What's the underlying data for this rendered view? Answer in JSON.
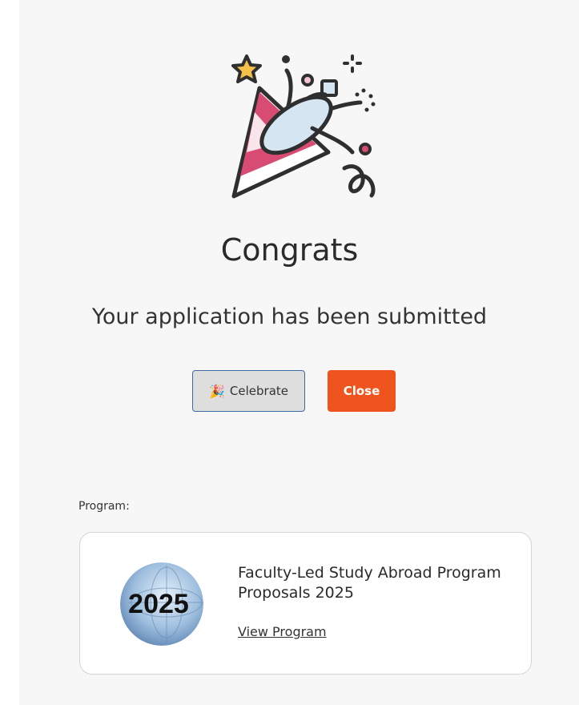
{
  "confirmation": {
    "title": "Congrats",
    "message": "Your application has been submitted"
  },
  "actions": {
    "celebrate_label": "Celebrate",
    "celebrate_icon": "party-popper-icon",
    "close_label": "Close"
  },
  "program": {
    "label": "Program:",
    "name": "Faculty-Led Study Abroad Program Proposals 2025",
    "link_text": "View Program",
    "logo_text": "2025"
  },
  "colors": {
    "accent": "#f0541e",
    "celebrate_border": "#3a6aa6",
    "popper_pink": "#d84b72",
    "popper_blue": "#d5e5f2",
    "star_yellow": "#f5c04a"
  }
}
